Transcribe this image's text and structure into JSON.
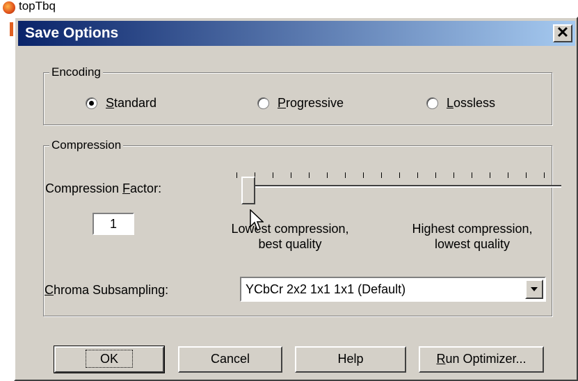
{
  "background": {
    "app_title": "topTbq"
  },
  "dialog": {
    "title": "Save Options",
    "close_glyph": "✕",
    "encoding": {
      "legend": "Encoding",
      "options": [
        {
          "label": "Standard",
          "accel": "S",
          "rest": "tandard",
          "checked": true
        },
        {
          "label": "Progressive",
          "accel": "P",
          "rest": "rogressive",
          "checked": false
        },
        {
          "label": "Lossless",
          "accel": "L",
          "rest": "ossless",
          "checked": false
        }
      ]
    },
    "compression": {
      "legend": "Compression",
      "factor_label_pre": "Compression ",
      "factor_label_accel": "F",
      "factor_label_post": "actor:",
      "factor_value": "1",
      "slider_value": 1,
      "slider_min_label_line1": "Lowest compression,",
      "slider_min_label_line2": "best quality",
      "slider_max_label_line1": "Highest compression,",
      "slider_max_label_line2": "lowest quality"
    },
    "chroma": {
      "label_accel": "C",
      "label_rest": "hroma Subsampling:",
      "selected": "YCbCr  2x2  1x1  1x1  (Default)"
    },
    "buttons": {
      "ok": "OK",
      "cancel": "Cancel",
      "help": "Help",
      "run_optimizer_accel": "R",
      "run_optimizer_rest": "un Optimizer..."
    }
  }
}
